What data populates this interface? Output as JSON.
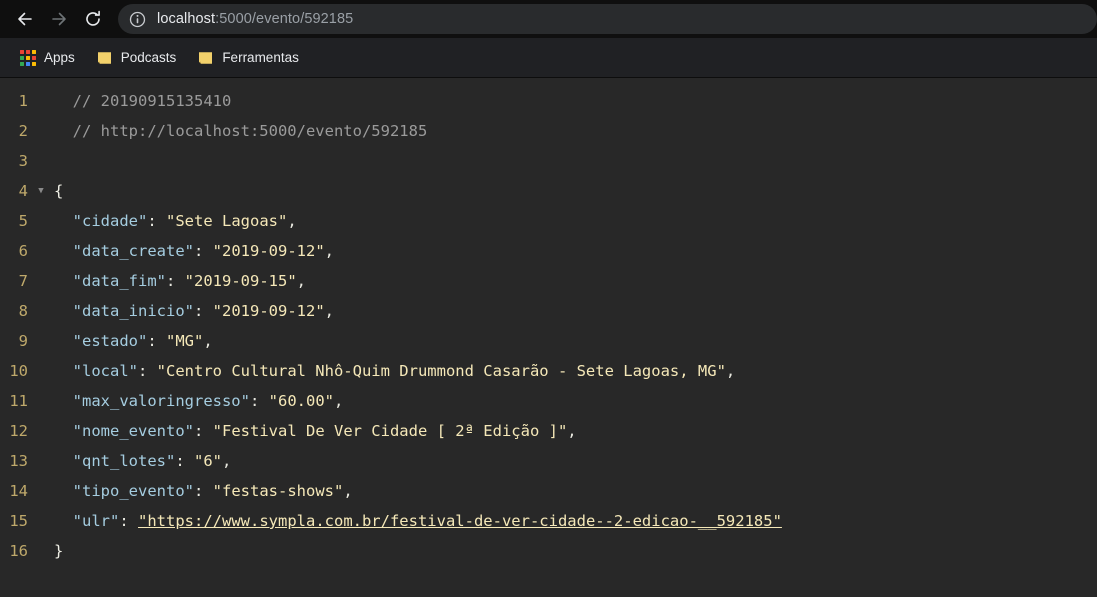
{
  "browser": {
    "toolbar": {
      "back_label": "Back",
      "forward_label": "Forward",
      "reload_label": "Reload",
      "back_enabled": true,
      "forward_enabled": false
    },
    "omnibox": {
      "site_info_label": "View site information",
      "url_host": "localhost",
      "url_rest": ":5000/evento/592185",
      "full_url": "localhost:5000/evento/592185"
    },
    "bookmarks": [
      {
        "name": "apps",
        "label": "Apps",
        "icon": "apps-grid-icon"
      },
      {
        "name": "podcasts",
        "label": "Podcasts",
        "icon": "folder-icon"
      },
      {
        "name": "ferramentas",
        "label": "Ferramentas",
        "icon": "folder-icon"
      }
    ]
  },
  "viewer": {
    "type": "json-viewer",
    "fold_marker_line": 4,
    "lines": [
      {
        "n": "1",
        "fold": false,
        "indent": 1,
        "tokens": [
          {
            "cls": "tok-comment",
            "t": "// 20190915135410"
          }
        ]
      },
      {
        "n": "2",
        "fold": false,
        "indent": 1,
        "tokens": [
          {
            "cls": "tok-comment",
            "t": "// http://localhost:5000/evento/592185"
          }
        ]
      },
      {
        "n": "3",
        "fold": false,
        "indent": 0,
        "tokens": []
      },
      {
        "n": "4",
        "fold": true,
        "indent": 0,
        "tokens": [
          {
            "cls": "tok-brace",
            "t": "{"
          }
        ]
      },
      {
        "n": "5",
        "fold": false,
        "indent": 1,
        "tokens": [
          {
            "cls": "tok-key",
            "t": "\"cidade\""
          },
          {
            "cls": "tok-punct",
            "t": ": "
          },
          {
            "cls": "tok-string",
            "t": "\"Sete Lagoas\""
          },
          {
            "cls": "tok-punct",
            "t": ","
          }
        ]
      },
      {
        "n": "6",
        "fold": false,
        "indent": 1,
        "tokens": [
          {
            "cls": "tok-key",
            "t": "\"data_create\""
          },
          {
            "cls": "tok-punct",
            "t": ": "
          },
          {
            "cls": "tok-string",
            "t": "\"2019-09-12\""
          },
          {
            "cls": "tok-punct",
            "t": ","
          }
        ]
      },
      {
        "n": "7",
        "fold": false,
        "indent": 1,
        "tokens": [
          {
            "cls": "tok-key",
            "t": "\"data_fim\""
          },
          {
            "cls": "tok-punct",
            "t": ": "
          },
          {
            "cls": "tok-string",
            "t": "\"2019-09-15\""
          },
          {
            "cls": "tok-punct",
            "t": ","
          }
        ]
      },
      {
        "n": "8",
        "fold": false,
        "indent": 1,
        "tokens": [
          {
            "cls": "tok-key",
            "t": "\"data_inicio\""
          },
          {
            "cls": "tok-punct",
            "t": ": "
          },
          {
            "cls": "tok-string",
            "t": "\"2019-09-12\""
          },
          {
            "cls": "tok-punct",
            "t": ","
          }
        ]
      },
      {
        "n": "9",
        "fold": false,
        "indent": 1,
        "tokens": [
          {
            "cls": "tok-key",
            "t": "\"estado\""
          },
          {
            "cls": "tok-punct",
            "t": ": "
          },
          {
            "cls": "tok-string",
            "t": "\"MG\""
          },
          {
            "cls": "tok-punct",
            "t": ","
          }
        ]
      },
      {
        "n": "10",
        "fold": false,
        "indent": 1,
        "tokens": [
          {
            "cls": "tok-key",
            "t": "\"local\""
          },
          {
            "cls": "tok-punct",
            "t": ": "
          },
          {
            "cls": "tok-string",
            "t": "\"Centro Cultural Nhô-Quim Drummond Casarão - Sete Lagoas, MG\""
          },
          {
            "cls": "tok-punct",
            "t": ","
          }
        ]
      },
      {
        "n": "11",
        "fold": false,
        "indent": 1,
        "tokens": [
          {
            "cls": "tok-key",
            "t": "\"max_valoringresso\""
          },
          {
            "cls": "tok-punct",
            "t": ": "
          },
          {
            "cls": "tok-string",
            "t": "\"60.00\""
          },
          {
            "cls": "tok-punct",
            "t": ","
          }
        ]
      },
      {
        "n": "12",
        "fold": false,
        "indent": 1,
        "tokens": [
          {
            "cls": "tok-key",
            "t": "\"nome_evento\""
          },
          {
            "cls": "tok-punct",
            "t": ": "
          },
          {
            "cls": "tok-string",
            "t": "\"Festival De Ver Cidade [ 2ª Edição ]\""
          },
          {
            "cls": "tok-punct",
            "t": ","
          }
        ]
      },
      {
        "n": "13",
        "fold": false,
        "indent": 1,
        "tokens": [
          {
            "cls": "tok-key",
            "t": "\"qnt_lotes\""
          },
          {
            "cls": "tok-punct",
            "t": ": "
          },
          {
            "cls": "tok-string",
            "t": "\"6\""
          },
          {
            "cls": "tok-punct",
            "t": ","
          }
        ]
      },
      {
        "n": "14",
        "fold": false,
        "indent": 1,
        "tokens": [
          {
            "cls": "tok-key",
            "t": "\"tipo_evento\""
          },
          {
            "cls": "tok-punct",
            "t": ": "
          },
          {
            "cls": "tok-string",
            "t": "\"festas-shows\""
          },
          {
            "cls": "tok-punct",
            "t": ","
          }
        ]
      },
      {
        "n": "15",
        "fold": false,
        "indent": 1,
        "tokens": [
          {
            "cls": "tok-key",
            "t": "\"ulr\""
          },
          {
            "cls": "tok-punct",
            "t": ": "
          },
          {
            "cls": "tok-link",
            "t": "\"https://www.sympla.com.br/festival-de-ver-cidade--2-edicao-__592185\"",
            "link": true
          }
        ]
      },
      {
        "n": "16",
        "fold": false,
        "indent": 0,
        "tokens": [
          {
            "cls": "tok-brace",
            "t": "}"
          }
        ]
      }
    ],
    "json_object": {
      "cidade": "Sete Lagoas",
      "data_create": "2019-09-12",
      "data_fim": "2019-09-15",
      "data_inicio": "2019-09-12",
      "estado": "MG",
      "local": "Centro Cultural Nhô-Quim Drummond Casarão - Sete Lagoas, MG",
      "max_valoringresso": "60.00",
      "nome_evento": "Festival De Ver Cidade [ 2ª Edição ]",
      "qnt_lotes": "6",
      "tipo_evento": "festas-shows",
      "ulr": "https://www.sympla.com.br/festival-de-ver-cidade--2-edicao-__592185"
    }
  },
  "colors": {
    "chrome_toolbar": "#0f0f0f",
    "chrome_bookmarks": "#202124",
    "omnibox_bg": "#292b2d",
    "viewer_bg": "#282828",
    "line_number": "#bfa96b",
    "comment": "#9b9b9b",
    "json_key": "#a5cde0",
    "json_string": "#f5e8b8",
    "folder_icon": "#f2d16b"
  }
}
